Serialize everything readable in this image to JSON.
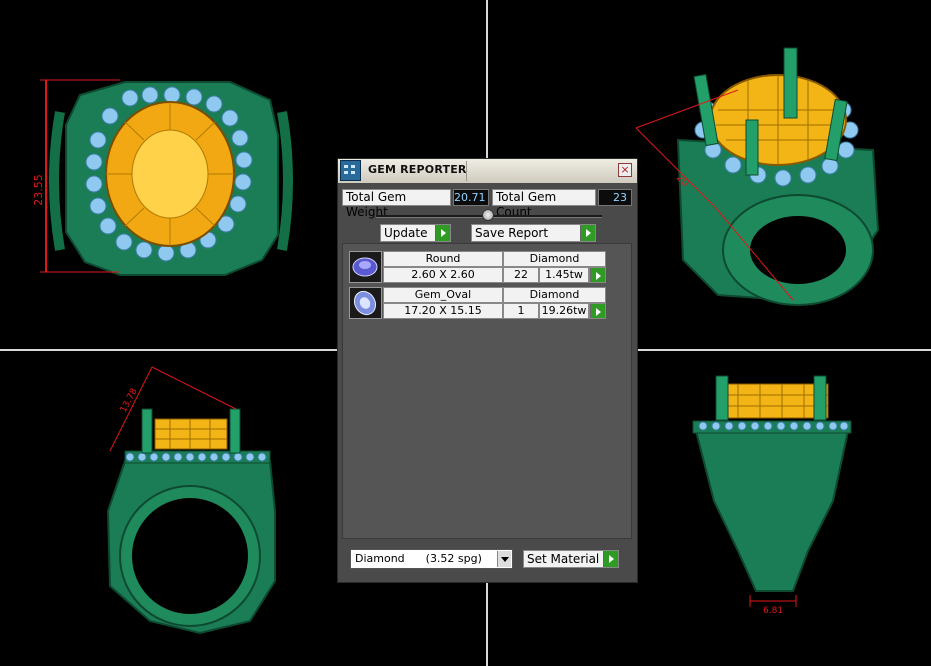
{
  "dimensions": {
    "front_height": "23.55",
    "top_right_width": "20",
    "side_height": "13.78",
    "shank_width": "6.81"
  },
  "panel": {
    "title": "GEM REPORTER",
    "total_weight_label": "Total Gem Weight",
    "total_weight_value": "20.71",
    "total_count_label": "Total Gem Count",
    "total_count_value": "23",
    "update_label": "Update",
    "save_report_label": "Save Report",
    "gems": [
      {
        "shape": "Round",
        "size": "2.60 X 2.60",
        "material": "Diamond",
        "count": "22",
        "weight": "1.45tw"
      },
      {
        "shape": "Gem_Oval",
        "size": "17.20 X 15.15",
        "material": "Diamond",
        "count": "1",
        "weight": "19.26tw"
      }
    ],
    "material_select": "Diamond      (3.52 spg)",
    "set_material_label": "Set Material"
  },
  "colors": {
    "metal": "#1f8a5c",
    "gem_gold": "#f2b515",
    "accent_stones": "#8fc9f0",
    "dimension_red": "#e01818"
  }
}
